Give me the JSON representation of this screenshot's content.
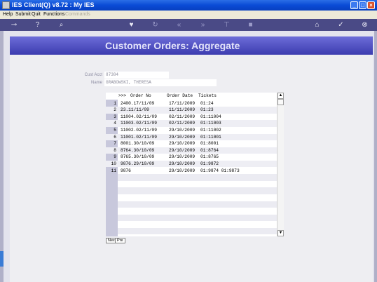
{
  "window": {
    "title": "IES Client(Q) v8.72 : My IES"
  },
  "menu": {
    "items": [
      "Help",
      "Submit",
      "Quit",
      "Functions",
      "Commands"
    ]
  },
  "screen": {
    "title": "Customer Orders: Aggregate"
  },
  "form": {
    "cust_acct_label": "Cust Acct",
    "cust_acct_value": "87384",
    "name_label": "Name",
    "name_value": "GRABOWSKI, THERESA"
  },
  "grid": {
    "headers": [
      ">>>",
      "Order No",
      "Order Date",
      "Tickets"
    ],
    "rows": [
      {
        "n": "1",
        "order": "2400.17/11/09",
        "date": "17/11/2009",
        "tickets": "01:24"
      },
      {
        "n": "2",
        "order": "23.11/11/09",
        "date": "11/11/2009",
        "tickets": "01:23"
      },
      {
        "n": "3",
        "order": "11004.02/11/09",
        "date": "02/11/2009",
        "tickets": "01:11004"
      },
      {
        "n": "4",
        "order": "11003.02/11/09",
        "date": "02/11/2009",
        "tickets": "01:11003"
      },
      {
        "n": "5",
        "order": "11002.02/11/09",
        "date": "29/10/2009",
        "tickets": "01:11002"
      },
      {
        "n": "6",
        "order": "11001.02/11/09",
        "date": "29/10/2009",
        "tickets": "01:11001"
      },
      {
        "n": "7",
        "order": "8001.30/10/09",
        "date": "29/10/2009",
        "tickets": "01:8001"
      },
      {
        "n": "8",
        "order": "8764.30/10/09",
        "date": "29/10/2009",
        "tickets": "01:8764"
      },
      {
        "n": "9",
        "order": "8765.30/10/09",
        "date": "29/10/2009",
        "tickets": "01:8765"
      },
      {
        "n": "10",
        "order": "9876.29/10/09",
        "date": "29/10/2009",
        "tickets": "01:9872"
      },
      {
        "n": "11",
        "order": "9876",
        "date": "29/10/2009",
        "tickets": "01:9874 01:9873"
      }
    ]
  },
  "buttons": {
    "next": "Nex",
    "prev": "Pre"
  }
}
